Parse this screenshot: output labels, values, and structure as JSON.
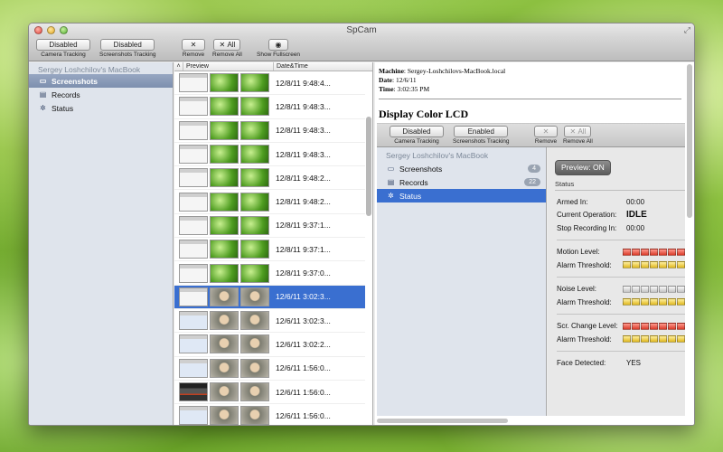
{
  "window": {
    "title": "SpCam"
  },
  "toolbar": {
    "camera_btn": "Disabled",
    "camera_label": "Camera Tracking",
    "shots_btn": "Disabled",
    "shots_label": "Screenshots Tracking",
    "remove_label": "Remove",
    "remove_all_btn": "All",
    "remove_all_label": "Remove All",
    "fullscreen_label": "Show Fullscreen"
  },
  "sidebar": {
    "header": "Sergey Loshchilov's MacBook",
    "items": [
      {
        "label": "Screenshots",
        "icon": "screen-icon",
        "selected": true
      },
      {
        "label": "Records",
        "icon": "film-icon",
        "selected": false
      },
      {
        "label": "Status",
        "icon": "gear-icon",
        "selected": false
      }
    ]
  },
  "list": {
    "columns": {
      "sort": "˄",
      "preview": "Preview",
      "date": "Date&Time"
    },
    "rows": [
      {
        "date": "12/8/11 9:48:4...",
        "thumbs": [
          "app",
          "leaf",
          "leaf"
        ],
        "selected": false
      },
      {
        "date": "12/8/11 9:48:3...",
        "thumbs": [
          "app",
          "leaf",
          "leaf"
        ],
        "selected": false
      },
      {
        "date": "12/8/11 9:48:3...",
        "thumbs": [
          "app",
          "leaf",
          "leaf"
        ],
        "selected": false
      },
      {
        "date": "12/8/11 9:48:3...",
        "thumbs": [
          "app",
          "leaf",
          "leaf"
        ],
        "selected": false
      },
      {
        "date": "12/8/11 9:48:2...",
        "thumbs": [
          "app",
          "leaf",
          "leaf"
        ],
        "selected": false
      },
      {
        "date": "12/8/11 9:48:2...",
        "thumbs": [
          "app",
          "leaf",
          "leaf"
        ],
        "selected": false
      },
      {
        "date": "12/8/11 9:37:1...",
        "thumbs": [
          "app",
          "leaf",
          "leaf"
        ],
        "selected": false
      },
      {
        "date": "12/8/11 9:37:1...",
        "thumbs": [
          "app",
          "leaf",
          "leaf"
        ],
        "selected": false
      },
      {
        "date": "12/8/11 9:37:0...",
        "thumbs": [
          "app",
          "leaf",
          "leaf"
        ],
        "selected": false
      },
      {
        "date": "12/6/11 3:02:3...",
        "thumbs": [
          "app",
          "face",
          "face"
        ],
        "selected": true
      },
      {
        "date": "12/6/11 3:02:3...",
        "thumbs": [
          "blue",
          "face",
          "face"
        ],
        "selected": false
      },
      {
        "date": "12/6/11 3:02:2...",
        "thumbs": [
          "blue",
          "face",
          "face"
        ],
        "selected": false
      },
      {
        "date": "12/6/11 1:56:0...",
        "thumbs": [
          "blue",
          "face",
          "face"
        ],
        "selected": false
      },
      {
        "date": "12/6/11 1:56:0...",
        "thumbs": [
          "dark",
          "face",
          "face"
        ],
        "selected": false
      },
      {
        "date": "12/6/11 1:56:0...",
        "thumbs": [
          "blue",
          "face",
          "face"
        ],
        "selected": false
      }
    ]
  },
  "detail": {
    "machine_label": "Machine",
    "machine": ": Sergey-Loshchilovs-MacBook.local",
    "date_label": "Date",
    "date": ": 12/6/11",
    "time_label": "Time",
    "time": ": 3:02:35 PM",
    "heading": "Display Color LCD"
  },
  "embedded": {
    "toolbar": {
      "camera_btn": "Disabled",
      "camera_label": "Camera Tracking",
      "shots_btn": "Enabled",
      "shots_label": "Screenshots Tracking",
      "remove_label": "Remove",
      "remove_all_btn": "All",
      "remove_all_label": "Remove All"
    },
    "sidebar": {
      "header": "Sergey Loshchilov's MacBook",
      "items": [
        {
          "label": "Screenshots",
          "badge": "4",
          "selected": false
        },
        {
          "label": "Records",
          "badge": "22",
          "selected": false
        },
        {
          "label": "Status",
          "badge": "",
          "selected": true
        }
      ]
    },
    "status": {
      "preview_btn": "Preview: ON",
      "title": "Status",
      "armed_label": "Armed In:",
      "armed_value": "00:00",
      "operation_label": "Current Operation:",
      "operation_value": "IDLE",
      "stop_label": "Stop Recording In:",
      "stop_value": "00:00",
      "motion_label": "Motion Level:",
      "motion_alarm_label": "Alarm Threshold:",
      "noise_label": "Noise Level:",
      "noise_alarm_label": "Alarm Threshold:",
      "scr_label": "Scr. Change Level:",
      "scr_alarm_label": "Alarm Threshold:",
      "face_label": "Face Detected:",
      "face_value": "YES"
    }
  },
  "colors": {
    "selection": "#3a6fd0",
    "sidebar_selection": "#7d8fae"
  }
}
